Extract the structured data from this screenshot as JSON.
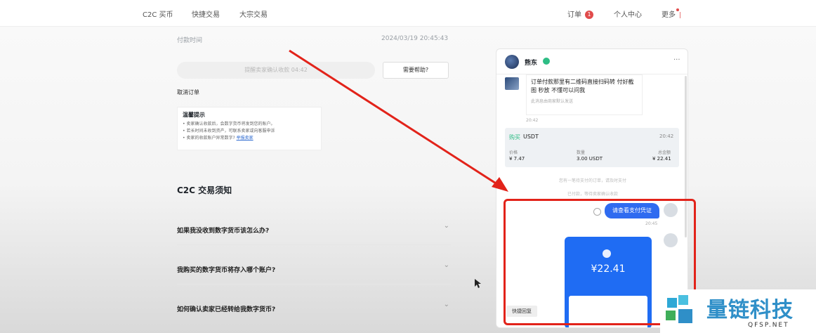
{
  "nav": {
    "left_items": [
      "C2C 买币",
      "快捷交易",
      "大宗交易"
    ],
    "orders_label": "订单",
    "orders_count": "1",
    "profile_label": "个人中心",
    "more_label": "更多"
  },
  "order": {
    "pay_time_label": "付款时间",
    "pay_time_value": "2024/03/19 20:45:43",
    "remind_button": "提醒卖家确认收款 04:42",
    "help_button": "需要帮助?",
    "cancel_label": "取消订单",
    "tips_title": "温馨提示",
    "tips": [
      "卖家确认收款后，会数字货币将发到您的账户。",
      "若长时间未收到资产，可联系卖家或向客服申诉",
      "卖家的收款账户异常数字?"
    ],
    "tips_link": "举报卖家"
  },
  "faq": {
    "title": "C2C 交易须知",
    "items": [
      "如果我没收到数字货币该怎么办?",
      "我购买的数字货币将存入哪个账户?",
      "如何确认卖家已经转给我数字货币?"
    ]
  },
  "chat": {
    "name": "熊东",
    "menu": "···",
    "merchant_msg": "订单付款那里有二维码直接扫码转 付好截图 秒放 不懂可以问我",
    "merchant_note": "此消息由商家默认发送",
    "merchant_time": "20:42",
    "order_side": "购买",
    "order_asset": "USDT",
    "order_time": "20:42",
    "price_label": "价格",
    "price_value": "¥ 7.47",
    "qty_label": "数量",
    "qty_value": "3.00 USDT",
    "total_label": "总金额",
    "total_value": "¥ 22.41",
    "sys_msg_1": "您有一笔待支付的订单，请及时支付",
    "sys_msg_2": "已付款，等待卖家确认收款",
    "user_msg": "请查看支付凭证",
    "user_msg_time": "20:45",
    "receipt_amount": "¥22.41",
    "quick_reply": "快捷回复"
  },
  "watermark": {
    "text": "量链科技",
    "sub": "QFSP.NET"
  },
  "colors": {
    "accent_blue": "#2f6bf0",
    "highlight_red": "#e2231a",
    "buy_green": "#2ebd85"
  }
}
